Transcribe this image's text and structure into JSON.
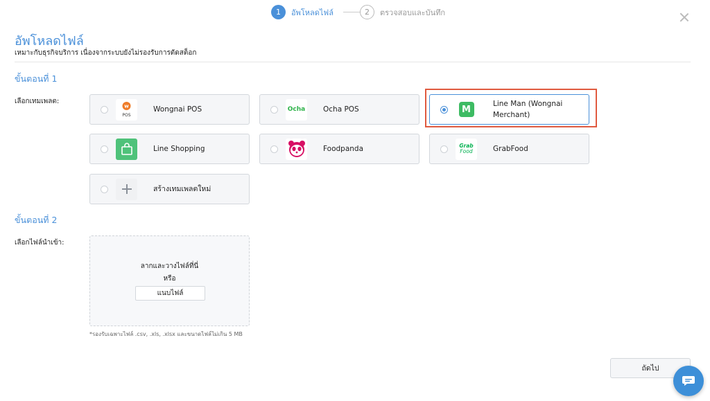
{
  "stepper": {
    "steps": [
      {
        "number": "1",
        "label": "อัพโหลดไฟล์",
        "active": true
      },
      {
        "number": "2",
        "label": "ตรวจสอบและบันทึก",
        "active": false
      }
    ]
  },
  "header": {
    "title": "อัพโหลดไฟล์",
    "subtitle": "เหมาะกับธุรกิจบริการ เนื่องจากระบบยังไม่รองรับการตัดสต็อก"
  },
  "step1": {
    "title": "ขั้นตอนที่ 1",
    "label": "เลือกเทมเพลต:",
    "templates": [
      {
        "label": "Wongnai POS",
        "logo": "wongnai-pos-logo",
        "logo_text": "POS",
        "selected": false
      },
      {
        "label": "Ocha POS",
        "logo": "ocha-logo",
        "logo_text": "Ocha",
        "selected": false
      },
      {
        "label": "Line Man (Wongnai Merchant)",
        "logo": "lineman-logo",
        "logo_text": "M",
        "selected": true
      },
      {
        "label": "Line Shopping",
        "logo": "shopping-bag-logo",
        "selected": false
      },
      {
        "label": "Foodpanda",
        "logo": "foodpanda-logo",
        "selected": false
      },
      {
        "label": "GrabFood",
        "logo": "grabfood-logo",
        "logo_text": "Grab\nFood",
        "selected": false
      },
      {
        "label": "สร้างเทมเพลตใหม่",
        "logo": "plus-icon",
        "selected": false
      }
    ]
  },
  "step2": {
    "title": "ขั้นตอนที่ 2",
    "label": "เลือกไฟล์นำเข้า:",
    "drop_text": "ลากและวางไฟล์ที่นี่",
    "or_text": "หรือ",
    "attach_label": "แนบไฟล์",
    "note": "*รองรับเฉพาะไฟล์ .csv, .xls, .xlsx และขนาดไฟล์ไม่เกิน 5 MB"
  },
  "footer": {
    "next_label": "ถัดไป"
  },
  "colors": {
    "accent": "#4a90d9",
    "highlight": "#e05a3f",
    "lineman_green": "#3dbb63",
    "foodpanda_pink": "#d70f64",
    "grab_green": "#00b14f"
  }
}
